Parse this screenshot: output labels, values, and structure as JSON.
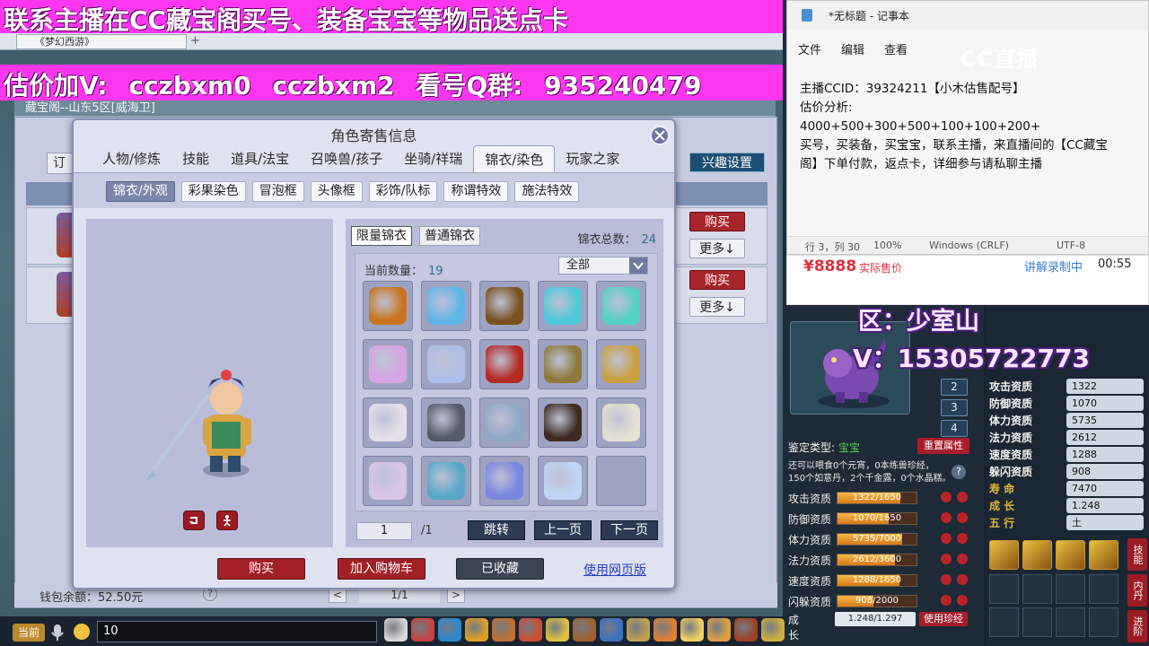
{
  "overlay": {
    "banner_top": "联系主播在CC藏宝阁买号、装备宝宝等物品送点卡",
    "banner_second": "估价加V:  cczbxm0  cczbxm2  看号Q群:  935240479",
    "zone": "区：少室山",
    "contact": "V：15305722773"
  },
  "game": {
    "browser_tab": "《梦幻西游》",
    "mall_title": "藏宝阁--山东5区[威海卫]",
    "order_tab": "订",
    "interest_button": "兴趣设置",
    "buy_label": "购买",
    "more_label": "更多↓",
    "wallet_label": "钱包余额：52.50元",
    "wallet_help": "?",
    "pager": "1/1",
    "chat_channel": "当前",
    "chat_input": "10"
  },
  "dialog": {
    "title": "角色寄售信息",
    "tabs": [
      "人物/修炼",
      "技能",
      "道具/法宝",
      "召唤兽/孩子",
      "坐骑/祥瑞",
      "锦衣/染色",
      "玩家之家"
    ],
    "active_tab": 5,
    "sub_tabs": [
      "锦衣/外观",
      "彩果染色",
      "冒泡框",
      "头像框",
      "彩饰/队标",
      "称谓特效",
      "施法特效"
    ],
    "active_sub_tab": 0,
    "type_buttons": [
      "限量锦衣",
      "普通锦衣"
    ],
    "total_label": "锦衣总数：",
    "total_value": "24",
    "count_label": "当前数量：",
    "count_value": "19",
    "filter": "全部",
    "page_input": "1",
    "page_total": "/1",
    "jump": "跳转",
    "prev": "上一页",
    "next": "下一页",
    "buy": "购买",
    "add_cart": "加入购物车",
    "favorited": "已收藏",
    "web_link": "使用网页版"
  },
  "items": [
    {
      "name": "fire-staff-icon",
      "color": "#c8741e"
    },
    {
      "name": "blue-wing-icon",
      "color": "#5fb6e8"
    },
    {
      "name": "shield-icon",
      "color": "#7a5222"
    },
    {
      "name": "cyan-spirit-icon",
      "color": "#4fc7d8"
    },
    {
      "name": "teal-spirit-icon",
      "color": "#53d1c2"
    },
    {
      "name": "pink-cloud-icon",
      "color": "#d7a4e6"
    },
    {
      "name": "swirl-cloud-icon",
      "color": "#aebfe8"
    },
    {
      "name": "red-armor-icon",
      "color": "#b22a22"
    },
    {
      "name": "halo-armor-icon",
      "color": "#8e7a3a"
    },
    {
      "name": "gold-armor-icon",
      "color": "#c9a042"
    },
    {
      "name": "white-robe-icon",
      "color": "#e4dfe8"
    },
    {
      "name": "dark-robe-icon",
      "color": "#555a68"
    },
    {
      "name": "blue-robe-icon",
      "color": "#8fa8c6"
    },
    {
      "name": "dark-beast-icon",
      "color": "#3e2a22"
    },
    {
      "name": "white-horse-icon",
      "color": "#e6e0d2"
    },
    {
      "name": "cat-ears-icon",
      "color": "#d9c6e6"
    },
    {
      "name": "ice-crown-icon",
      "color": "#58a8c8"
    },
    {
      "name": "spark-icon",
      "color": "#7a86e0"
    },
    {
      "name": "ice-crystal-icon",
      "color": "#bfd4f6"
    }
  ],
  "notepad": {
    "title": "*无标题 - 记事本",
    "menu": [
      "文件",
      "编辑",
      "查看"
    ],
    "lines": [
      "主播CCID：39324211【小木估售配号】",
      "估价分析:",
      "4000+500+300+500+100+100+200+",
      "买号，买装备，买宝宝，联系主播，来直播间的【CC藏宝",
      "阁】下单付款，返点卡，详细参与请私聊主播"
    ],
    "status": [
      "行 3，列 30",
      "100%",
      "Windows (CRLF)",
      "UTF-8"
    ],
    "logo": "CC直播"
  },
  "price": {
    "value": "¥8888",
    "label": "实际售价",
    "live_label": "讲解录制中",
    "live_time": "00:55"
  },
  "pet": {
    "numbers": [
      "2",
      "3",
      "4"
    ],
    "identify_label": "鉴定类型:",
    "identify_value": "宝宝",
    "reset_button": "重置属性",
    "note1": "还可以喂食0个元宵，0本练兽珍经，",
    "note2": "150个如意丹，2个千金露，0个水晶糕。",
    "help": "?",
    "bars": [
      {
        "label": "攻击资质",
        "text": "1322/1650",
        "ratio": 0.801
      },
      {
        "label": "防御资质",
        "text": "1070/1650",
        "ratio": 0.648
      },
      {
        "label": "体力资质",
        "text": "5735/7000",
        "ratio": 0.819
      },
      {
        "label": "法力资质",
        "text": "2612/3600",
        "ratio": 0.726
      },
      {
        "label": "速度资质",
        "text": "1288/1650",
        "ratio": 0.781
      },
      {
        "label": "闪躲资质",
        "text": "908/2000",
        "ratio": 0.454
      }
    ],
    "growth_label": "成  长",
    "growth_value": "1.248/1.297",
    "use_gem": "使用珍经",
    "stats": [
      {
        "label": "攻击资质",
        "value": "1322"
      },
      {
        "label": "防御资质",
        "value": "1070"
      },
      {
        "label": "体力资质",
        "value": "5735"
      },
      {
        "label": "法力资质",
        "value": "2612"
      },
      {
        "label": "速度资质",
        "value": "1288"
      },
      {
        "label": "躲闪资质",
        "value": "908"
      },
      {
        "label": "寿    命",
        "value": "7470"
      },
      {
        "label": "成    长",
        "value": "1.248"
      },
      {
        "label": "五    行",
        "value": "土"
      }
    ],
    "side_buttons": [
      "技能",
      "内丹",
      "进阶"
    ]
  }
}
